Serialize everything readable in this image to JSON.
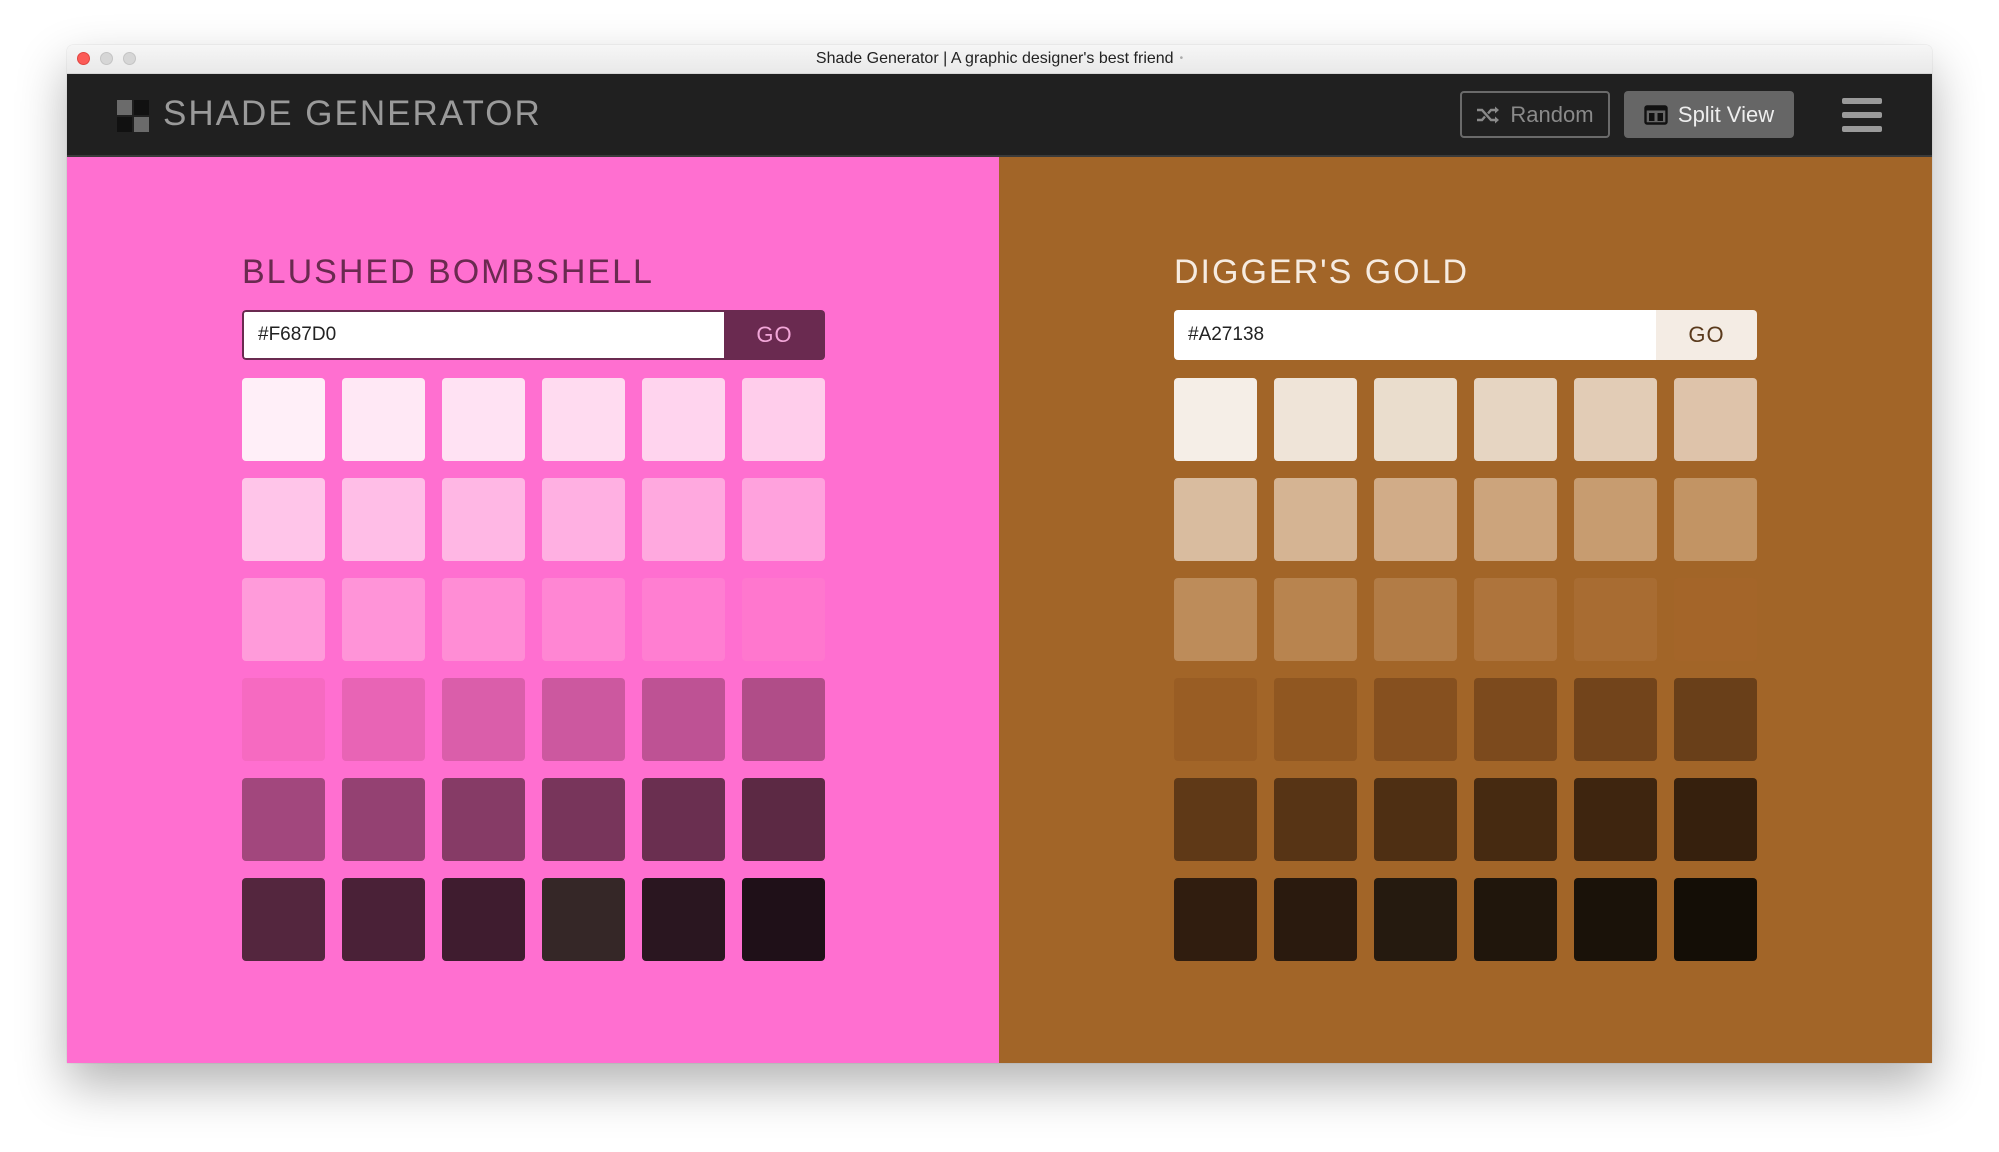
{
  "window": {
    "title": "Shade Generator | A graphic designer's best friend",
    "title_dot": "•"
  },
  "header": {
    "brand": "SHADE GENERATOR",
    "logo_colors": [
      "#6b6b6b",
      "#111111",
      "#111111",
      "#6b6b6b"
    ],
    "random_label": "Random",
    "random_icon": "shuffle-icon",
    "split_label": "Split View",
    "split_icon": "split-view-icon",
    "menu_icon": "hamburger-menu-icon"
  },
  "panels": [
    {
      "name": "BLUSHED BOMBSHELL",
      "hex": "#F687D0",
      "go_label": "GO",
      "background": "#FF6FD0",
      "name_color": "#6a2a50",
      "go_bg": "#6a2a50",
      "go_color": "#f2a7d8",
      "swatches": [
        "#FFEFF8",
        "#FFE8F5",
        "#FFE2F3",
        "#FFDBF0",
        "#FFD4EE",
        "#FFCDEB",
        "#FFC5E9",
        "#FFBEE7",
        "#FFB7E4",
        "#FFB0E2",
        "#FFA9DF",
        "#FFA2DD",
        "#FF9BDA",
        "#FF94D8",
        "#FF8DD5",
        "#FF86D3",
        "#FF7ED1",
        "#FF77CE",
        "#F66AC1",
        "#E864B5",
        "#DA5EAA",
        "#CC589F",
        "#BE5294",
        "#B04D88",
        "#A2477D",
        "#944172",
        "#863B66",
        "#78355B",
        "#6A2F50",
        "#5C2944",
        "#54263E",
        "#4A2137",
        "#3F1C2F",
        "#352727",
        "#2A1620",
        "#1F1018"
      ]
    },
    {
      "name": "DIGGER'S GOLD",
      "hex": "#A27138",
      "go_label": "GO",
      "background": "#A26528",
      "name_color": "#f6ebe0",
      "go_bg": "#f4ece4",
      "go_color": "#5a3a1c",
      "swatches": [
        "#F5EEE7",
        "#EFE4D8",
        "#EADDCD",
        "#E6D5C2",
        "#E2CCB6",
        "#DEC3AA",
        "#D9BC9F",
        "#D5B493",
        "#D1AC88",
        "#CCA47C",
        "#C79C70",
        "#C29464",
        "#BD8C5A",
        "#B8844F",
        "#B27C46",
        "#AE743C",
        "#A86C32",
        "#A46529",
        "#995D24",
        "#905721",
        "#86501F",
        "#7C4A1D",
        "#72441B",
        "#693F19",
        "#5F3917",
        "#573415",
        "#4E2F13",
        "#462A11",
        "#3E250F",
        "#36200D",
        "#301D0F",
        "#2A1A0E",
        "#251A0F",
        "#20160C",
        "#1A1209",
        "#140E06"
      ]
    }
  ]
}
